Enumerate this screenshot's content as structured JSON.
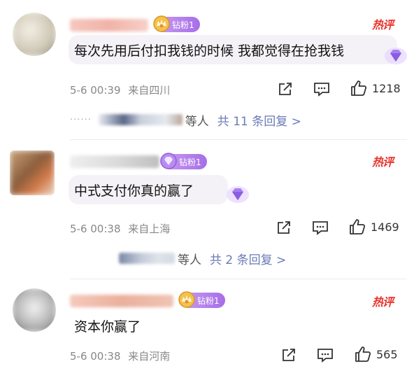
{
  "comments": [
    {
      "badge_label": "钻粉1",
      "hot_label": "热评",
      "text": "每次先用后付扣我钱的时候 我都觉得在抢我钱",
      "date": "5-6 00:39",
      "location": "来自四川",
      "likes": "1218",
      "replies_suffix": "等人",
      "replies_count": "共 11 条回复 >"
    },
    {
      "badge_label": "钻粉1",
      "hot_label": "热评",
      "text": "中式支付你真的赢了",
      "date": "5-6 00:38",
      "location": "来自上海",
      "likes": "1469",
      "replies_suffix": "等人",
      "replies_count": "共 2 条回复 >"
    },
    {
      "badge_label": "钻粉1",
      "hot_label": "热评",
      "text": "资本你赢了",
      "date": "5-6 00:38",
      "location": "来自河南",
      "likes": "565"
    }
  ],
  "icons": {
    "share": "share-icon",
    "comment": "comment-icon",
    "like": "thumbs-up-icon",
    "badge": "crown-badge-icon",
    "gem": "diamond-gem-icon"
  },
  "colors": {
    "accent_purple": "#a66ee8",
    "hot_red": "#e8342c",
    "reply_link": "#6a7bb6"
  }
}
